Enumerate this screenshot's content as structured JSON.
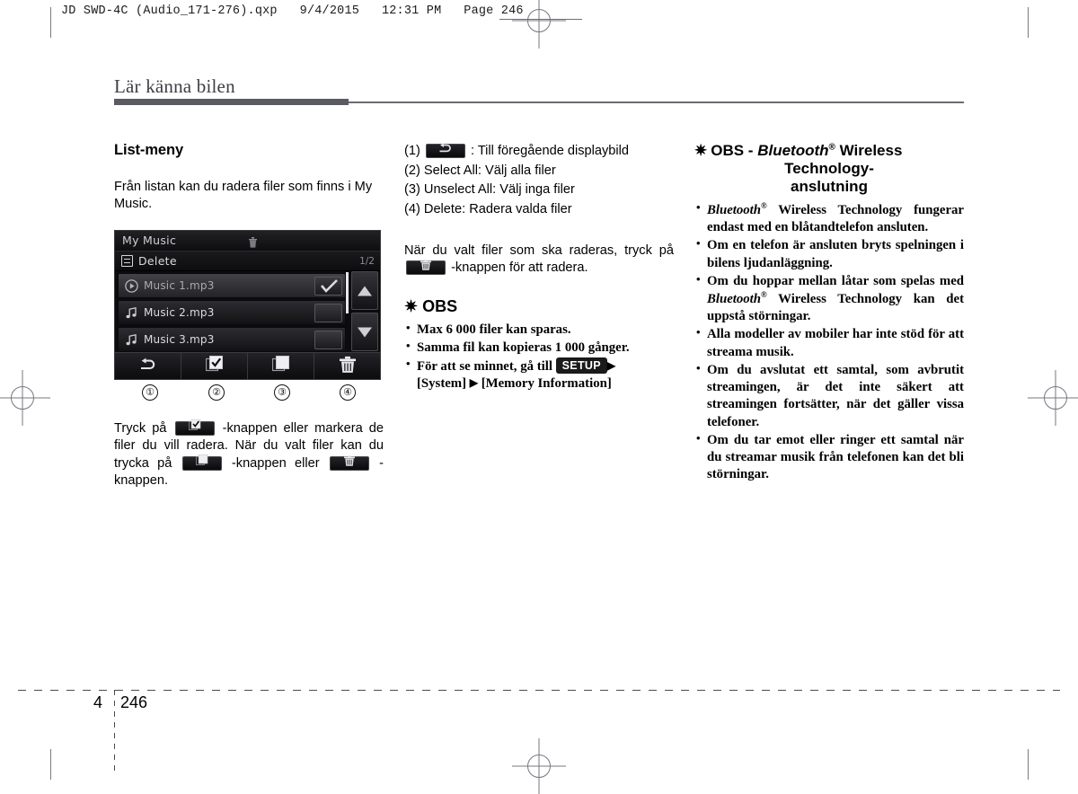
{
  "print_slug": "JD SWD-4C (Audio_171-276).qxp   9/4/2015   12:31 PM   Page 246",
  "chapter": {
    "title": "Lär känna bilen"
  },
  "footer": {
    "chapter_number": "4",
    "page_number": "246"
  },
  "column_left": {
    "heading": "List-meny",
    "intro": "Från listan kan du radera filer som finns i My Music.",
    "device": {
      "title": "My Music",
      "trash_icon": "trash-icon",
      "menu_icon": "list-menu-icon",
      "subtitle": "Delete",
      "page_indicator": "1/2",
      "rows": [
        {
          "label": "Music 1.mp3",
          "icon": "play-circle-icon",
          "checked": true,
          "playing": true
        },
        {
          "label": "Music 2.mp3",
          "icon": "music-note-icon",
          "checked": false,
          "playing": false
        },
        {
          "label": "Music 3.mp3",
          "icon": "music-note-icon",
          "checked": false,
          "playing": false
        }
      ],
      "scroll_up_icon": "arrow-up-icon",
      "scroll_down_icon": "arrow-down-icon",
      "toolbar": [
        {
          "icon": "back-arrow-icon",
          "callout": "①"
        },
        {
          "icon": "select-all-icon",
          "callout": "②"
        },
        {
          "icon": "unselect-all-icon",
          "callout": "③"
        },
        {
          "icon": "delete-trash-icon",
          "callout": "④"
        }
      ]
    },
    "instruction_parts": {
      "p1": "Tryck på",
      "p2": "-knappen eller markera de filer du vill radera. När du valt filer kan du trycka på",
      "p3": "-knappen eller",
      "p4": "-knappen."
    }
  },
  "column_middle": {
    "numbered_items": [
      {
        "num": "(1)",
        "icon": "back-arrow-icon",
        "text": ": Till föregående displaybild"
      },
      {
        "num": "(2)",
        "text": "Select All: Välj alla filer"
      },
      {
        "num": "(3)",
        "text": "Unselect All: Välj inga filer"
      },
      {
        "num": "(4)",
        "text": "Delete: Radera valda filer"
      }
    ],
    "paragraph_parts": {
      "p1": "När du valt filer som ska raderas, tryck på",
      "p2": "-knappen för att radera."
    },
    "note": {
      "asterisk": "✷",
      "heading": "OBS",
      "items": [
        "Max 6 000 filer kan sparas.",
        "Samma fil kan kopieras 1 000 gånger.",
        "För att se minnet, gå till"
      ],
      "setup_badge": "SETUP",
      "arrow": "▶",
      "path_rest_1": "[System]",
      "path_rest_2": "[Memory Information]"
    }
  },
  "column_right": {
    "note": {
      "asterisk": "✷",
      "heading_prefix": "OBS - ",
      "heading_brand": "Bluetooth",
      "heading_sup": "®",
      "heading_rest": " Wireless",
      "heading_line2": "Technology-",
      "heading_line3": "anslutning",
      "items": [
        {
          "brand": "Bluetooth",
          "sup": "®",
          "text": " Wireless Technology fungerar endast med en blåtandtelefon ansluten."
        },
        {
          "text": "Om en telefon är ansluten bryts spelningen i bilens ljudanläggning."
        },
        {
          "text_before": "Om du hoppar mellan låtar som spelas med ",
          "brand": "Bluetooth",
          "sup": "®",
          "text_after": " Wireless Technology kan det uppstå störningar."
        },
        {
          "text": "Alla modeller av mobiler har inte stöd för att streama musik."
        },
        {
          "text": "Om du avslutat ett samtal, som avbrutit streamingen, är det inte säkert att streamingen fortsätter, när det gäller vissa telefoner."
        },
        {
          "text": "Om du tar emot eller ringer ett samtal när du streamar musik från telefonen kan det bli störningar."
        }
      ]
    }
  }
}
